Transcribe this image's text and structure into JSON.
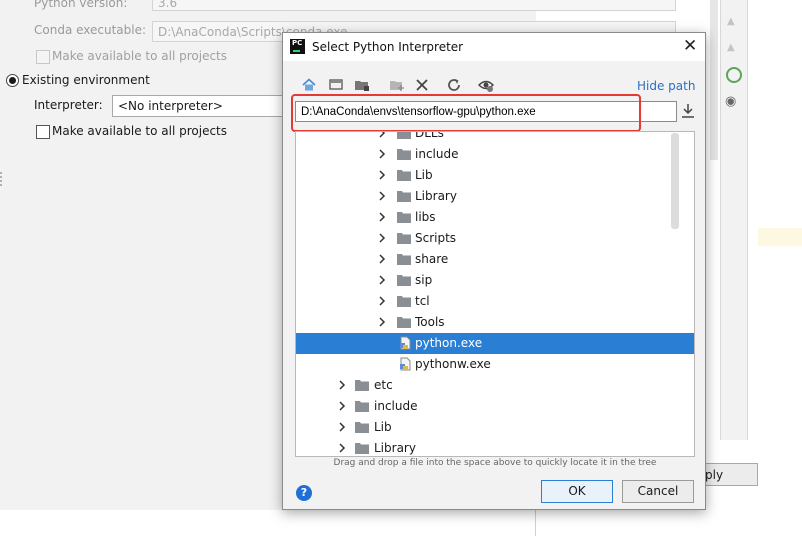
{
  "background": {
    "python_version_label": "Python version:",
    "python_version_value": "3.6",
    "conda_label": "Conda executable:",
    "conda_value": "D:\\AnaConda\\Scripts\\conda.exe",
    "make_available_1": "Make available to all projects",
    "existing_env_label": "Existing environment",
    "interpreter_label": "Interpreter:",
    "interpreter_value": "<No interpreter>",
    "make_available_2": "Make available to all projects",
    "apply_label": "ply"
  },
  "dialog": {
    "title": "Select Python Interpreter",
    "logo_text": "PC",
    "hide_path": "Hide path",
    "path_value": "D:\\AnaConda\\envs\\tensorflow-gpu\\python.exe",
    "hint": "Drag and drop a file into the space above to quickly locate it in the tree",
    "ok": "OK",
    "cancel": "Cancel",
    "help_glyph": "?"
  },
  "tree": [
    {
      "label": "DLLs",
      "type": "folder",
      "level": 2
    },
    {
      "label": "include",
      "type": "folder",
      "level": 2
    },
    {
      "label": "Lib",
      "type": "folder",
      "level": 2
    },
    {
      "label": "Library",
      "type": "folder",
      "level": 2
    },
    {
      "label": "libs",
      "type": "folder",
      "level": 2
    },
    {
      "label": "Scripts",
      "type": "folder",
      "level": 2
    },
    {
      "label": "share",
      "type": "folder",
      "level": 2
    },
    {
      "label": "sip",
      "type": "folder",
      "level": 2
    },
    {
      "label": "tcl",
      "type": "folder",
      "level": 2
    },
    {
      "label": "Tools",
      "type": "folder",
      "level": 2
    },
    {
      "label": "python.exe",
      "type": "file",
      "level": 2,
      "selected": true
    },
    {
      "label": "pythonw.exe",
      "type": "file",
      "level": 2
    },
    {
      "label": "etc",
      "type": "folder",
      "level": 1
    },
    {
      "label": "include",
      "type": "folder",
      "level": 1
    },
    {
      "label": "Lib",
      "type": "folder",
      "level": 1
    },
    {
      "label": "Library",
      "type": "folder",
      "level": 1
    }
  ],
  "colors": {
    "selection": "#2a7fd4",
    "highlight_box": "#e53935",
    "link": "#2a6fc4"
  }
}
